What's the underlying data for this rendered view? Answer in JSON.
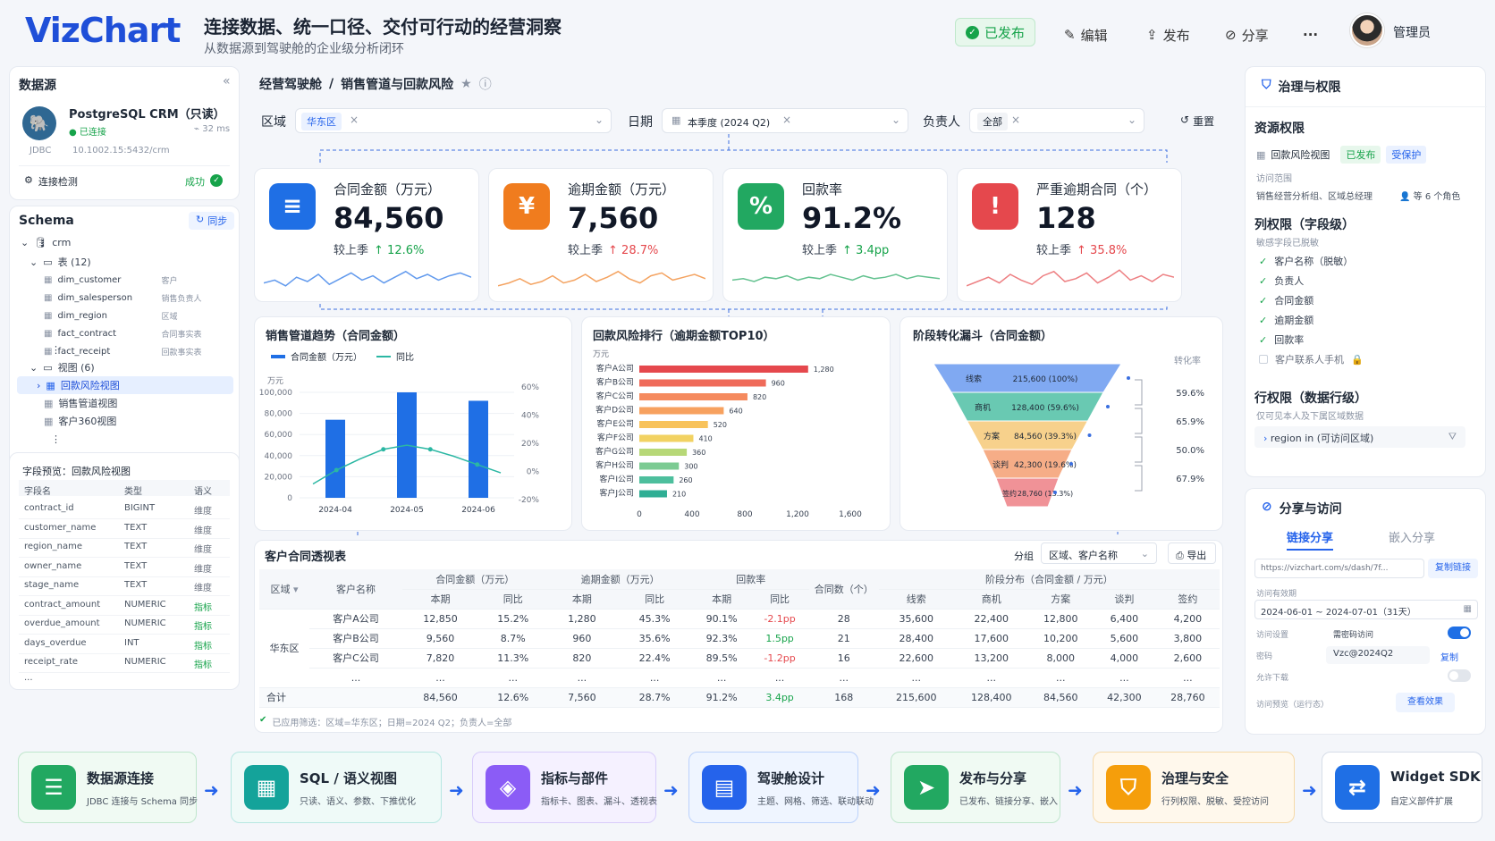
{
  "header": {
    "logo": "VizChart",
    "title": "连接数据、统一口径、交付可行动的经营洞察",
    "subtitle": "从数据源到驾驶舱的企业级分析闭环",
    "status_badge": "已发布",
    "edit": "编辑",
    "publish": "发布",
    "share": "分享",
    "more": "···",
    "user": "管理员"
  },
  "datasource": {
    "title": "数据源",
    "name": "PostgreSQL CRM（只读）",
    "status": "已连接",
    "latency": "32 ms",
    "type": "JDBC",
    "host": "10.1002.15:5432/crm",
    "check_label": "连接检测",
    "check_result": "成功"
  },
  "schema": {
    "title": "Schema",
    "sync": "同步",
    "db": "crm",
    "tables_label": "表 (12)",
    "tables": [
      {
        "name": "dim_customer",
        "desc": "客户"
      },
      {
        "name": "dim_salesperson",
        "desc": "销售负责人"
      },
      {
        "name": "dim_region",
        "desc": "区域"
      },
      {
        "name": "fact_contract",
        "desc": "合同事实表"
      },
      {
        "name": "fact_receipt",
        "desc": "回款事实表"
      }
    ],
    "views_label": "视图 (6)",
    "views": [
      "回款风险视图",
      "销售管道视图",
      "客户360视图"
    ],
    "ellipsis": "⋮"
  },
  "field_preview": {
    "title": "字段预览：回款风险视图",
    "headers": [
      "字段名",
      "类型",
      "语义"
    ],
    "rows": [
      [
        "contract_id",
        "BIGINT",
        "维度"
      ],
      [
        "customer_name",
        "TEXT",
        "维度"
      ],
      [
        "region_name",
        "TEXT",
        "维度"
      ],
      [
        "owner_name",
        "TEXT",
        "维度"
      ],
      [
        "stage_name",
        "TEXT",
        "维度"
      ],
      [
        "contract_amount",
        "NUMERIC",
        "指标"
      ],
      [
        "overdue_amount",
        "NUMERIC",
        "指标"
      ],
      [
        "days_overdue",
        "INT",
        "指标"
      ],
      [
        "receipt_rate",
        "NUMERIC",
        "指标"
      ]
    ],
    "more": "..."
  },
  "dashboard": {
    "breadcrumb_root": "经营驾驶舱",
    "breadcrumb_sep": "/",
    "breadcrumb_page": "销售管道与回款风险",
    "filters": {
      "region_label": "区域",
      "region_value": "华东区",
      "date_label": "日期",
      "date_value": "本季度 (2024 Q2)",
      "owner_label": "负责人",
      "owner_value": "全部",
      "reset": "重置"
    },
    "kpis": [
      {
        "label": "合同金额（万元）",
        "value": "84,560",
        "compare": "较上季",
        "change": "12.6%",
        "dir": "up",
        "color": "#1f6fe5",
        "icon": "contract-icon",
        "glyph": "≡",
        "spark": [
          12,
          14,
          10,
          16,
          13,
          18,
          11,
          15,
          19,
          14,
          17,
          12,
          16,
          20,
          15,
          18,
          14,
          17,
          19,
          16
        ]
      },
      {
        "label": "逾期金额（万元）",
        "value": "7,560",
        "compare": "较上季",
        "change": "28.7%",
        "dir": "up",
        "color": "#f07c1e",
        "icon": "yen-coin-icon",
        "glyph": "¥",
        "spark": [
          10,
          12,
          15,
          11,
          13,
          17,
          12,
          14,
          18,
          13,
          16,
          20,
          15,
          12,
          17,
          19,
          14,
          16,
          18,
          15
        ]
      },
      {
        "label": "回款率",
        "value": "91.2%",
        "compare": "较上季",
        "change": "3.4pp",
        "dir": "up",
        "color": "#22a861",
        "icon": "percent-icon",
        "glyph": "%",
        "spark": [
          14,
          15,
          13,
          16,
          15,
          17,
          14,
          16,
          15,
          18,
          16,
          14,
          17,
          15,
          16,
          18,
          15,
          17,
          16,
          15
        ]
      },
      {
        "label": "严重逾期合同（个）",
        "value": "128",
        "compare": "较上季",
        "change": "35.8%",
        "dir": "up",
        "color": "#e5484d",
        "icon": "warning-icon",
        "glyph": "!",
        "spark": [
          10,
          13,
          16,
          12,
          18,
          14,
          11,
          17,
          20,
          13,
          15,
          19,
          12,
          16,
          21,
          14,
          17,
          13,
          18,
          16
        ]
      }
    ]
  },
  "trend_chart": {
    "title": "销售管道趋势（合同金额）",
    "legend_bar": "合同金额（万元）",
    "legend_line": "同比",
    "y_unit": "万元"
  },
  "rank_chart": {
    "title": "回款风险排行（逾期金额TOP10）",
    "y_unit": "万元"
  },
  "funnel_chart": {
    "title": "阶段转化漏斗（合同金额）",
    "rate_label": "转化率"
  },
  "chart_data": [
    {
      "type": "bar",
      "title": "销售管道趋势（合同金额）",
      "categories": [
        "2024-04",
        "2024-05",
        "2024-06"
      ],
      "series": [
        {
          "name": "合同金额（万元）",
          "type": "bar",
          "values": [
            74000,
            100000,
            92000
          ]
        },
        {
          "name": "同比",
          "type": "line",
          "x": [
            0,
            0.5,
            1,
            1.5,
            2,
            2.5,
            3,
            3.5,
            4
          ],
          "values": [
            -10,
            0,
            8,
            15,
            18,
            15,
            10,
            4,
            -2
          ]
        }
      ],
      "ylabel": "万元",
      "ylim": [
        0,
        100000
      ],
      "yticks": [
        "100,000",
        "80,000",
        "60,000",
        "40,000",
        "20,000",
        "0"
      ],
      "y2lim": [
        -20,
        60
      ],
      "y2ticks": [
        "60%",
        "40%",
        "20%",
        "0%",
        "-20%"
      ]
    },
    {
      "type": "bar",
      "orientation": "horizontal",
      "title": "回款风险排行（逾期金额TOP10）",
      "categories": [
        "客户A公司",
        "客户B公司",
        "客户C公司",
        "客户D公司",
        "客户E公司",
        "客户F公司",
        "客户G公司",
        "客户H公司",
        "客户I公司",
        "客户J公司"
      ],
      "values": [
        1280,
        960,
        820,
        640,
        520,
        410,
        360,
        300,
        260,
        210
      ],
      "xlim": [
        0,
        1600
      ],
      "xticks": [
        "0",
        "400",
        "800",
        "1,200",
        "1,600"
      ],
      "ylabel": "万元"
    },
    {
      "type": "funnel",
      "title": "阶段转化漏斗（合同金额）",
      "stages": [
        {
          "name": "线索",
          "value": 215600,
          "label": "215,600 (100%)"
        },
        {
          "name": "商机",
          "value": 128400,
          "label": "128,400 (59.6%)"
        },
        {
          "name": "方案",
          "value": 84560,
          "label": "84,560 (39.3%)"
        },
        {
          "name": "谈判",
          "value": 42300,
          "label": "42,300 (19.6%)"
        },
        {
          "name": "签约",
          "value": 28760,
          "label": "28,760 (13.3%)"
        }
      ],
      "conversion_rates": [
        "59.6%",
        "65.9%",
        "50.0%",
        "67.9%"
      ]
    }
  ],
  "pivot": {
    "title": "客户合同透视表",
    "group_label": "分组",
    "group_value": "区域、客户名称",
    "export": "导出",
    "h_region": "区域",
    "h_customer": "客户名称",
    "h_groups": [
      "合同金额（万元）",
      "逾期金额（万元）",
      "回款率"
    ],
    "h_sub": [
      "本期",
      "同比"
    ],
    "h_count": "合同数（个）",
    "h_stage": "阶段分布（合同金额 / 万元）",
    "h_stages": [
      "线索",
      "商机",
      "方案",
      "谈判",
      "签约"
    ],
    "region": "华东区",
    "rows": [
      [
        "客户A公司",
        "12,850",
        "15.2%",
        "1,280",
        "45.3%",
        "90.1%",
        "-2.1pp",
        "28",
        "35,600",
        "22,400",
        "12,800",
        "6,400",
        "4,200"
      ],
      [
        "客户B公司",
        "9,560",
        "8.7%",
        "960",
        "35.6%",
        "92.3%",
        "1.5pp",
        "21",
        "28,400",
        "17,600",
        "10,200",
        "5,600",
        "3,800"
      ],
      [
        "客户C公司",
        "7,820",
        "11.3%",
        "820",
        "22.4%",
        "89.5%",
        "-1.2pp",
        "16",
        "22,600",
        "13,200",
        "8,000",
        "4,000",
        "2,600"
      ],
      [
        "...",
        "...",
        "...",
        "...",
        "...",
        "...",
        "...",
        "...",
        "...",
        "...",
        "...",
        "...",
        "..."
      ]
    ],
    "total": [
      "合计",
      "84,560",
      "12.6%",
      "7,560",
      "28.7%",
      "91.2%",
      "3.4pp",
      "168",
      "215,600",
      "128,400",
      "84,560",
      "42,300",
      "28,760"
    ],
    "applied": "已应用筛选：区域=华东区；日期=2024 Q2；负责人=全部"
  },
  "governance": {
    "title": "治理与权限",
    "res_title": "资源权限",
    "res_name": "回款风险视图",
    "res_badge1": "已发布",
    "res_badge2": "受保护",
    "scope_label": "访问范围",
    "scope_value": "销售经营分析组、区域总经理",
    "scope_more": "等 6 个角色",
    "col_title": "列权限（字段级）",
    "col_sub": "敏感字段已脱敏",
    "cols": [
      "客户名称（脱敏）",
      "负责人",
      "合同金额",
      "逾期金额",
      "回款率",
      "客户联系人手机"
    ],
    "row_title": "行权限（数据行级）",
    "row_sub": "仅可见本人及下属区域数据",
    "row_rule": "region in (可访问区域)"
  },
  "share": {
    "title": "分享与访问",
    "tab1": "链接分享",
    "tab2": "嵌入分享",
    "url": "https://vizchart.com/s/dash/7f...",
    "copy_link": "复制链接",
    "valid_label": "访问有效期",
    "valid_value": "2024-06-01 ~ 2024-07-01（31天）",
    "setting_label": "访问设置",
    "setting_value": "需密码访问",
    "pwd_label": "密码",
    "pwd_value": "Vzc@2024Q2",
    "copy": "复制",
    "download_label": "允许下载",
    "preview_label": "访问预览（运行态）",
    "preview_btn": "查看效果"
  },
  "flow": [
    {
      "title": "数据源连接",
      "sub": "JDBC 连接与 Schema 同步",
      "icon": "database-icon",
      "color": "#22a861",
      "bg": "#f0faf3",
      "border": "#bfe6cc",
      "glyph": "☰"
    },
    {
      "title": "SQL / 语义视图",
      "sub": "只读、语义、参数、下推优化",
      "icon": "table-grid-icon",
      "color": "#14a39a",
      "bg": "#effaf8",
      "border": "#b7e7e2",
      "glyph": "▦"
    },
    {
      "title": "指标与部件",
      "sub": "指标卡、图表、漏斗、透视表",
      "icon": "cube-icon",
      "color": "#8b5cf6",
      "bg": "#f5f1ff",
      "border": "#d8ccfa",
      "glyph": "◈"
    },
    {
      "title": "驾驶舱设计",
      "sub": "主题、网格、筛选、联动联动",
      "icon": "layout-icon",
      "color": "#2563eb",
      "bg": "#eff5ff",
      "border": "#bcd2fb",
      "glyph": "▤"
    },
    {
      "title": "发布与分享",
      "sub": "已发布、链接分享、嵌入",
      "icon": "paper-plane-icon",
      "color": "#22a861",
      "bg": "#f0faf3",
      "border": "#bfe6cc",
      "glyph": "➤"
    },
    {
      "title": "治理与安全",
      "sub": "行列权限、脱敏、受控访问",
      "icon": "shield-icon",
      "color": "#f59e0b",
      "bg": "#fff8ec",
      "border": "#f5d9a8",
      "glyph": "⛉"
    },
    {
      "title": "Widget SDK",
      "sub": "自定义部件扩展",
      "icon": "sdk-icon",
      "color": "#1f6fe5",
      "bg": "#fff",
      "border": "#d6dde8",
      "glyph": "⇄"
    }
  ]
}
